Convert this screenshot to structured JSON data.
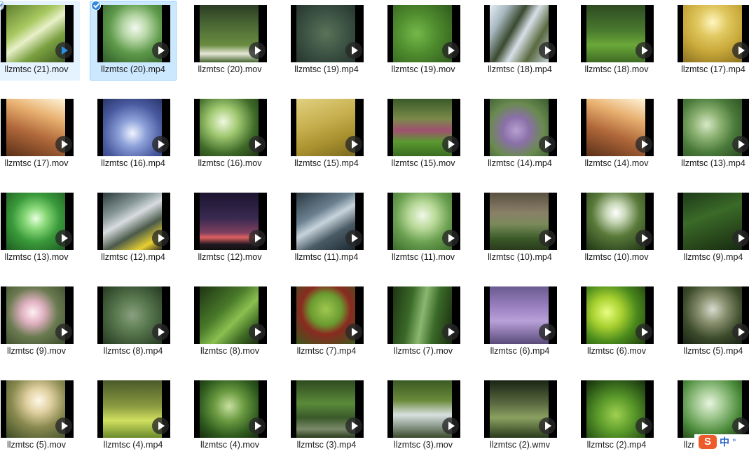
{
  "files": [
    {
      "name": "llzmtsc (21).mov",
      "selected": false,
      "hovered": true,
      "bg": "linear-gradient(145deg,#5f7f2f 0%,#a8c860 35%,#e8f0c8 50%,#7aa040 70%,#3e5a20 100%)",
      "play_icon": "play-icon-blue"
    },
    {
      "name": "llzmtsc (20).mp4",
      "selected": true,
      "bg": "radial-gradient(circle at 55% 40%,#f4f8f0 0%,#b8d8a8 25%,#5e9a4a 55%,#2f5a28 100%)",
      "play_icon": "play-icon"
    },
    {
      "name": "llzmtsc (20).mov",
      "bg": "linear-gradient(180deg,#2c3d24 0%,#4f6e36 40%,#6a8c40 70%,#e6e8d8 85%,#46632e 100%)",
      "play_icon": "play-icon"
    },
    {
      "name": "llzmtsc (19).mp4",
      "bg": "radial-gradient(circle at 50% 50%,#5a7358 0%,#3d5445 50%,#26352d 100%)",
      "play_icon": "play-icon"
    },
    {
      "name": "llzmtsc (19).mov",
      "bg": "radial-gradient(circle at 40% 50%,#76b84a 0%,#4f8c2e 45%,#2f5a1c 100%)",
      "play_icon": "play-icon"
    },
    {
      "name": "llzmtsc (18).mp4",
      "bg": "linear-gradient(120deg,#e8eef4 0%,#a8b8c0 20%,#3a4a30 40%,#d8e0e8 55%,#5a6a40 75%,#c0ccd4 100%)",
      "play_icon": "play-icon"
    },
    {
      "name": "llzmtsc (18).mov",
      "bg": "linear-gradient(180deg,#2e4a22 0%,#4a7a2e 45%,#6aa838 70%,#3f6a24 100%)",
      "play_icon": "play-icon"
    },
    {
      "name": "llzmtsc (17).mp4",
      "bg": "radial-gradient(circle at 50% 30%,#fff6c0 0%,#e0c860 30%,#c8a83a 60%,#8a7020 100%)",
      "play_icon": "play-icon"
    },
    {
      "name": "llzmtsc (17).mov",
      "bg": "linear-gradient(200deg,#fff4d8 0%,#e8b070 30%,#b0683a 60%,#5a3018 100%)",
      "play_icon": "play-icon"
    },
    {
      "name": "llzmtsc (16).mp4",
      "bg": "radial-gradient(circle at 50% 60%,#f0f4ff 0%,#8ca0d8 30%,#4a5aa0 65%,#283468 100%)",
      "play_icon": "play-icon"
    },
    {
      "name": "llzmtsc (16).mov",
      "bg": "radial-gradient(circle at 40% 40%,#f0f8e0 0%,#a0c870 30%,#3e6a28 65%,#1e3414 100%)",
      "play_icon": "play-icon"
    },
    {
      "name": "llzmtsc (15).mp4",
      "bg": "linear-gradient(160deg,#e0d080 0%,#c8b050 40%,#a8902e 70%,#7a6a20 100%)",
      "play_icon": "play-icon"
    },
    {
      "name": "llzmtsc (15).mov",
      "bg": "linear-gradient(180deg,#3a5a28 0%,#7a8a4a 35%,#a05070 55%,#5a9a30 75%,#3a6a20 100%)",
      "play_icon": "play-icon"
    },
    {
      "name": "llzmtsc (14).mp4",
      "bg": "radial-gradient(circle at 45% 55%,#b8a0d0 0%,#8a70a8 30%,#6a8a50 60%,#3a5a30 100%)",
      "play_icon": "play-icon"
    },
    {
      "name": "llzmtsc (14).mov",
      "bg": "linear-gradient(200deg,#fff4d8 0%,#e8b070 30%,#b0683a 60%,#5a3018 100%)",
      "play_icon": "play-icon"
    },
    {
      "name": "llzmtsc (13).mp4",
      "bg": "radial-gradient(circle at 40% 45%,#d8e8c8 0%,#8ab070 30%,#4a7a3a 60%,#2a4a22 100%)",
      "play_icon": "play-icon"
    },
    {
      "name": "llzmtsc (13).mov",
      "bg": "radial-gradient(circle at 50% 45%,#e8ffe0 0%,#88d878 25%,#3a9a3a 55%,#1e5a22 100%)",
      "play_icon": "play-icon"
    },
    {
      "name": "llzmtsc (12).mp4",
      "bg": "linear-gradient(150deg,#2a3a3a 0%,#8a9a9a 30%,#d8dce0 45%,#4a5a4a 65%,#e8d030 85%,#2a2a20 100%)",
      "play_icon": "play-icon"
    },
    {
      "name": "llzmtsc (12).mov",
      "bg": "linear-gradient(180deg,#1a1430 0%,#3a2a50 45%,#804060 70%,#e06060 78%,#201820 90%,#101010 100%)",
      "play_icon": "play-icon"
    },
    {
      "name": "llzmtsc (11).mp4",
      "bg": "linear-gradient(150deg,#2a3840 0%,#6a8090 35%,#c8d4dc 50%,#4a5a64 70%,#1a2830 100%)",
      "play_icon": "play-icon"
    },
    {
      "name": "llzmtsc (11).mov",
      "bg": "radial-gradient(circle at 50% 40%,#f0f8e8 0%,#b8d898 30%,#6aa050 60%,#3a6a2a 100%)",
      "play_icon": "play-icon"
    },
    {
      "name": "llzmtsc (10).mp4",
      "bg": "linear-gradient(180deg,#5a5040 0%,#8a8068 35%,#7a8a5a 55%,#3a5a28 80%,#2a3a1c 100%)",
      "play_icon": "play-icon"
    },
    {
      "name": "llzmtsc (10).mov",
      "bg": "radial-gradient(circle at 50% 35%,#ffffff 0%,#c8d8b8 20%,#5a7a3a 50%,#1e3414 100%)",
      "play_icon": "play-icon"
    },
    {
      "name": "llzmtsc (9).mp4",
      "bg": "linear-gradient(160deg,#1e3a18 0%,#3a6a28 40%,#2a4a1c 70%,#162a10 100%)",
      "play_icon": "play-icon"
    },
    {
      "name": "llzmtsc (9).mov",
      "bg": "radial-gradient(circle at 45% 45%,#fff0f4 0%,#e0b0c0 25%,#6a7a50 55%,#3a4a2a 100%)",
      "play_icon": "play-icon"
    },
    {
      "name": "llzmtsc (8).mp4",
      "bg": "radial-gradient(circle at 50% 50%,#8aa080 0%,#5a7a50 40%,#3a5434 75%,#243820 100%)",
      "play_icon": "play-icon"
    },
    {
      "name": "llzmtsc (8).mov",
      "bg": "linear-gradient(135deg,#1e3414 0%,#4a7a2a 40%,#8ac050 60%,#3e6a24 80%,#1a2a10 100%)",
      "play_icon": "play-icon"
    },
    {
      "name": "llzmtsc (7).mp4",
      "bg": "radial-gradient(circle at 50% 40%,#a0c850 0%,#6a9a30 35%,#8a2a20 55%,#3a5a1c 100%)",
      "play_icon": "play-icon"
    },
    {
      "name": "llzmtsc (7).mov",
      "bg": "linear-gradient(100deg,#1e3414 0%,#3a6a28 30%,#8ab870 50%,#3a6a28 70%,#1a2a10 100%)",
      "play_icon": "play-icon"
    },
    {
      "name": "llzmtsc (6).mp4",
      "bg": "linear-gradient(180deg,#6a5a90 0%,#9a80c0 35%,#b8a0d8 60%,#5a4a7a 100%)",
      "play_icon": "play-icon"
    },
    {
      "name": "llzmtsc (6).mov",
      "bg": "radial-gradient(circle at 35% 45%,#e8ff80 0%,#a8d030 30%,#4a8a1c 60%,#1e3a10 100%)",
      "play_icon": "play-icon"
    },
    {
      "name": "llzmtsc (5).mp4",
      "bg": "radial-gradient(circle at 50% 40%,#d8dcd0 0%,#8a9070 30%,#3a4a2a 65%,#1a2414 100%)",
      "play_icon": "play-icon"
    },
    {
      "name": "llzmtsc (5).mov",
      "bg": "radial-gradient(circle at 55% 35%,#fff8e8 0%,#e0d0a0 25%,#8a8a50 55%,#3a4a24 100%)",
      "play_icon": "play-icon"
    },
    {
      "name": "llzmtsc (4).mp4",
      "bg": "linear-gradient(180deg,#4a5a2a 0%,#8a9a40 45%,#d0e060 70%,#6a8a2a 100%)",
      "play_icon": "play-icon"
    },
    {
      "name": "llzmtsc (4).mov",
      "bg": "radial-gradient(circle at 50% 45%,#c8e0a0 0%,#6a9a40 35%,#2e5a1e 70%,#162a0e 100%)",
      "play_icon": "play-icon"
    },
    {
      "name": "llzmtsc (3).mp4",
      "bg": "linear-gradient(180deg,#2e4a1e 0%,#5a8a3a 40%,#3a5a2a 65%,#7a8a6a 85%,#2a3a1c 100%)",
      "play_icon": "play-icon"
    },
    {
      "name": "llzmtsc (3).mov",
      "bg": "linear-gradient(180deg,#3a5a24 0%,#6a8a3a 35%,#d8e0e0 60%,#8a9a8a 80%,#3a4a2a 100%)",
      "play_icon": "play-icon"
    },
    {
      "name": "llzmtsc (2).wmv",
      "bg": "linear-gradient(180deg,#1a2414 0%,#5a6a40 40%,#8aa060 65%,#2a3a1c 100%)",
      "play_icon": "play-icon"
    },
    {
      "name": "llzmtsc (2).mp4",
      "bg": "radial-gradient(circle at 50% 60%,#a0d050 0%,#5a9a2a 40%,#2e5a18 75%,#162a0c 100%)",
      "play_icon": "play-icon"
    },
    {
      "name": "llzmtsc (1).mp4",
      "bg": "radial-gradient(circle at 45% 40%,#e8f4e0 0%,#a0c890 30%,#4a8a3a 65%,#1e3a14 100%)",
      "play_icon": "play-icon"
    }
  ],
  "ime": {
    "logo": "S",
    "lang": "中",
    "extra": "°"
  }
}
